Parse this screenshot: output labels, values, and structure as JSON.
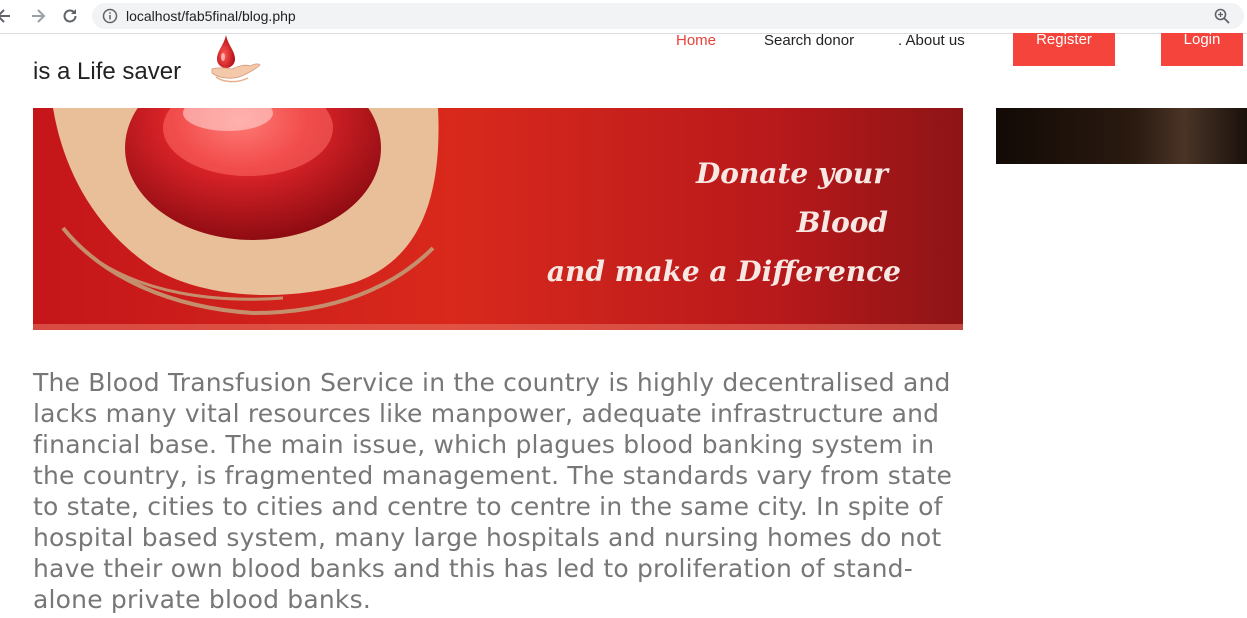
{
  "browser": {
    "url": "localhost/fab5final/blog.php"
  },
  "header": {
    "tagline": "is a Life saver",
    "menu": [
      {
        "label": "Home"
      },
      {
        "label": "Search donor"
      },
      {
        "label": ". About us"
      }
    ],
    "register_label": "Register",
    "login_label": "Login"
  },
  "banner": {
    "line1": "Donate your",
    "line2": "Blood",
    "line3": "and make a Difference"
  },
  "article": {
    "text": "The Blood Transfusion Service in the country is highly decentralised and lacks many vital resources like manpower, adequate infrastructure and financial base. The main issue, which plagues blood banking system in the country, is fragmented management. The standards vary from state to state, cities to cities and centre to centre in the same city. In spite of hospital based system, many large hospitals and nursing homes do not have their own blood banks and this has led to proliferation of stand-alone private blood banks."
  },
  "colors": {
    "accent": "#f4443c",
    "active_link": "#e8403a",
    "body_text": "#777777"
  },
  "icons": [
    "back-arrow-icon",
    "forward-arrow-icon",
    "reload-icon",
    "info-icon",
    "zoom-icon",
    "blood-drop-hand-logo"
  ]
}
